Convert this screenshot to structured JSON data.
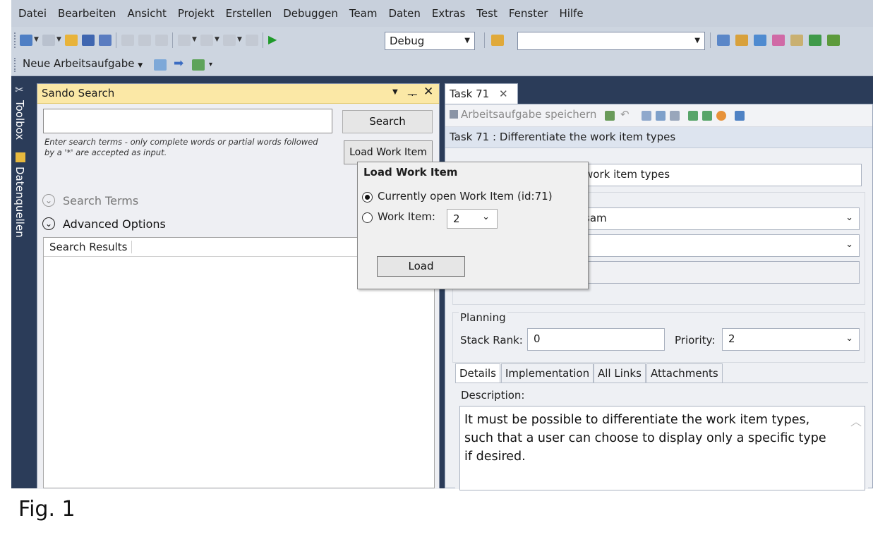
{
  "menu": [
    "Datei",
    "Bearbeiten",
    "Ansicht",
    "Projekt",
    "Erstellen",
    "Debuggen",
    "Team",
    "Daten",
    "Extras",
    "Test",
    "Fenster",
    "Hilfe"
  ],
  "toolbar": {
    "config_value": "Debug",
    "platform_value": "",
    "new_work_item_label": "Neue Arbeitsaufgabe"
  },
  "side_tabs": {
    "toolbox": "Toolbox",
    "data_sources": "Datenquellen"
  },
  "sando": {
    "title": "Sando Search",
    "search_value": "",
    "search_button": "Search",
    "load_work_item_button": "Load Work Item",
    "hint": "Enter search terms - only complete words or partial words followed by a '*' are accepted as input.",
    "search_terms_label": "Search Terms",
    "advanced_options_label": "Advanced Options",
    "results_header": "Search Results"
  },
  "popup": {
    "title": "Load Work Item",
    "option_current": "Currently open Work Item (id:71)",
    "option_work_item": "Work Item:",
    "work_item_value": "2",
    "load_button": "Load"
  },
  "work_item": {
    "tab_label": "Task 71",
    "save_label": "Arbeitsaufgabe speichern",
    "header_title": "Task 71 : Differentiate the work item types",
    "title_field_visible": "work item types",
    "assigned_visible": "sam",
    "planning_label": "Planning",
    "stack_rank_label": "Stack Rank:",
    "stack_rank_value": "0",
    "priority_label": "Priority:",
    "priority_value": "2",
    "tabs": [
      "Details",
      "Implementation",
      "All Links",
      "Attachments"
    ],
    "description_label": "Description:",
    "description_text": "It must be possible to differentiate the work item types, such that a user can choose to display only a specific type if desired."
  },
  "caption": "Fig. 1"
}
